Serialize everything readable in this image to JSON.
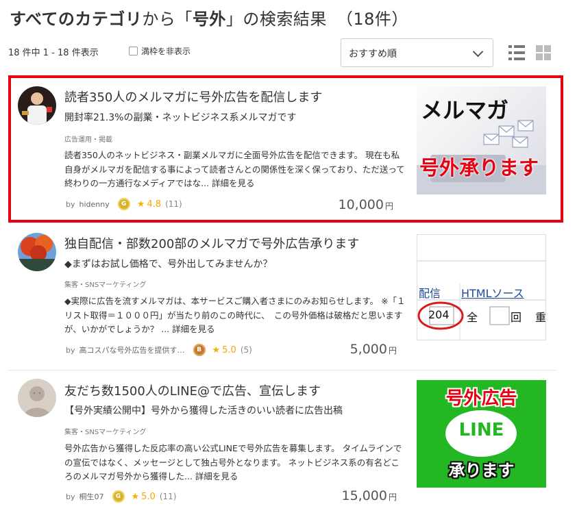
{
  "header": {
    "title_bold": "すべてのカテゴリ",
    "title_from": "から「",
    "title_keyword": "号外",
    "title_rest": "」の検索結果",
    "title_count": "（18件）"
  },
  "toolbar": {
    "result_count": "18 件中 1 - 18 件表示",
    "hide_full_label": "満枠を非表示",
    "sort_value": "おすすめ順"
  },
  "items": [
    {
      "title": "読者350人のメルマガに号外広告を配信します",
      "subtitle": "開封率21.3%の副業・ネットビジネス系メルマガです",
      "category": "広告運用・掲載",
      "desc": "読者350人のネットビジネス・副業メルマガに全面号外広告を配信できます。 現在も私自身がメルマガを配信する事によって読者さんとの関係性を深く保っており、ただ送って終わりの一方通行なメディアではな...",
      "more": "詳細を見る",
      "by": "by",
      "seller": "hidenny",
      "badge": "G",
      "star": "★",
      "rating": "4.8",
      "reviews": "(11)",
      "price": "10,000",
      "yen": "円",
      "thumb_line1": "メルマガ",
      "thumb_line2": "号外承ります"
    },
    {
      "title": "独自配信・部数200部のメルマガで号外広告承ります",
      "subtitle": "◆まずはお試し価格で、号外出してみませんか？",
      "category": "集客・SNSマーケティング",
      "desc": "◆実際に広告を流すメルマガは、本サービスご購入者さまにのみお知らせします。 ※「１リスト取得＝１０００円」が当たり前のこの時代に、　この号外価格は破格だと思いますが、いかがでしょうか？ ...",
      "more": "詳細を見る",
      "by": "by",
      "seller": "高コスパな号外広告を提供す…",
      "badge": "B",
      "star": "★",
      "rating": "5.0",
      "reviews": "(5)",
      "price": "5,000",
      "yen": "円",
      "thumb_t1": "配信",
      "thumb_t2": "HTMLソース",
      "thumb_t3": "204",
      "thumb_t4": "全",
      "thumb_t5": "回",
      "thumb_t6": "重"
    },
    {
      "title": "友だち数1500人のLINE@で広告、宣伝します",
      "subtitle": "【号外実績公開中】号外から獲得した活きのいい読者に広告出稿",
      "category": "集客・SNSマーケティング",
      "desc": "号外広告から獲得した反応率の高い公式LINEで号外広告を募集します。 タイムラインでの宣伝ではなく、メッセージとして独占号外となります。 ネットビジネス系の有名どころのメルマガ号外から獲得した...",
      "more": "詳細を見る",
      "by": "by",
      "seller": "桐生07",
      "badge": "G",
      "star": "★",
      "rating": "5.0",
      "reviews": "(11)",
      "price": "15,000",
      "yen": "円",
      "thumb_line1": "号外広告",
      "thumb_line2": "LINE",
      "thumb_line3": "承ります"
    }
  ],
  "colors": {
    "highlight": "#e60012",
    "star": "#f5b301",
    "line_green": "#22b723"
  }
}
